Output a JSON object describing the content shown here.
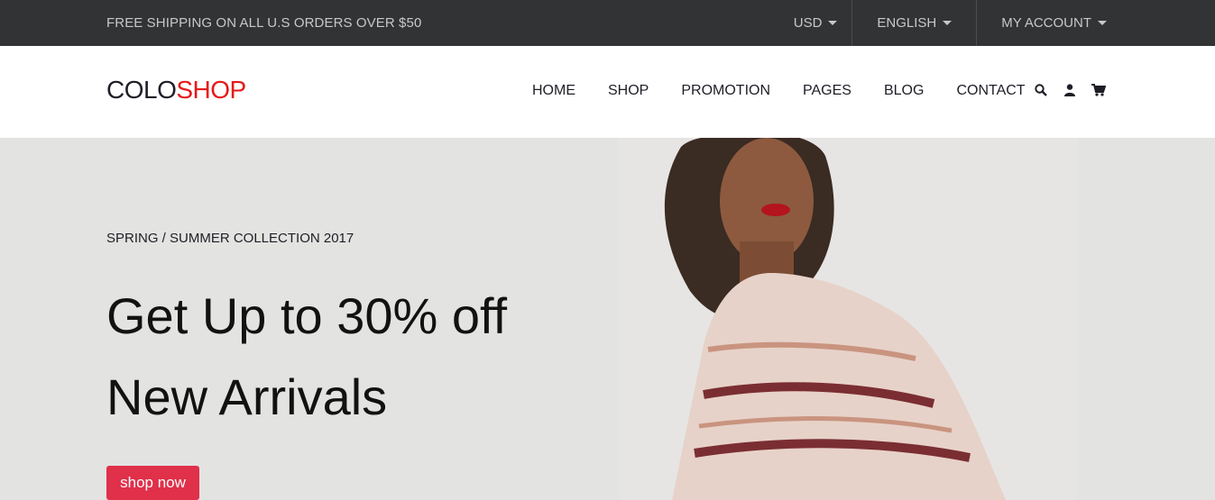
{
  "topbar": {
    "message": "FREE SHIPPING ON ALL U.S ORDERS OVER $50",
    "currency": "USD",
    "language": "ENGLISH",
    "account": "MY ACCOUNT"
  },
  "header": {
    "logo": {
      "part1": "COLO",
      "part2": "SHOP"
    },
    "nav": [
      "HOME",
      "SHOP",
      "PROMOTION",
      "PAGES",
      "BLOG",
      "CONTACT"
    ],
    "icons": [
      "search-icon",
      "user-icon",
      "cart-icon"
    ]
  },
  "hero": {
    "subtitle": "SPRING / SUMMER COLLECTION 2017",
    "title_line1": "Get Up to 30% off",
    "title_line2": "New Arrivals",
    "cta": "shop now"
  },
  "colors": {
    "topbar_bg": "#323334",
    "accent_red": "#e51a1a",
    "button_red": "#e0304a",
    "hero_bg": "#e3e3e1"
  }
}
